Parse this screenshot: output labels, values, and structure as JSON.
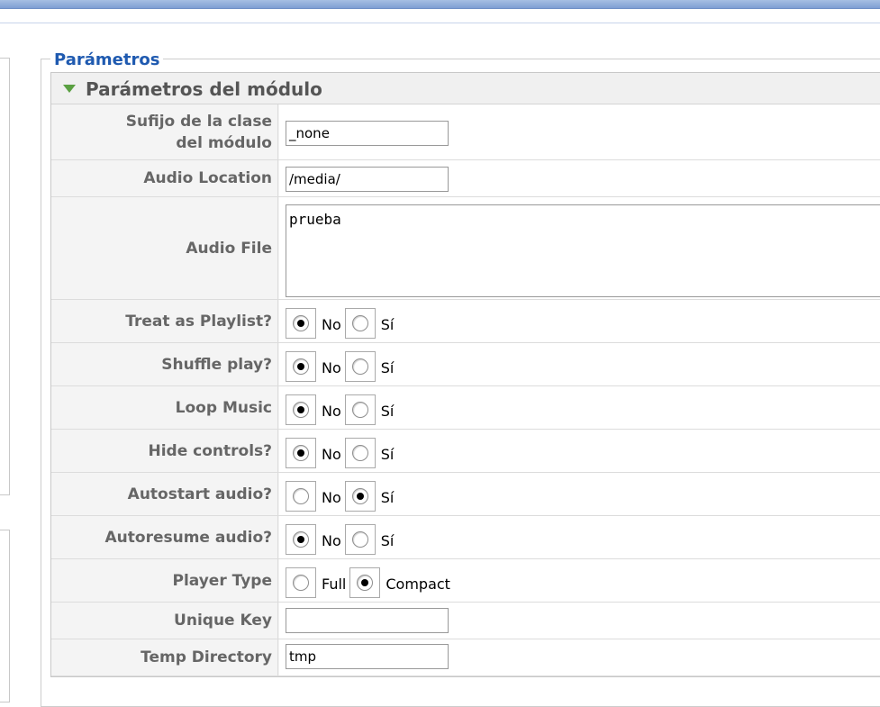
{
  "fieldset": {
    "legend": "Parámetros"
  },
  "panel": {
    "title": "Parámetros del módulo",
    "toggle_icon": "triangle-down-icon",
    "accent_color": "#5aa042"
  },
  "fields": {
    "module_class_suffix": {
      "label": "Sufijo de la clase del módulo",
      "value": "_none"
    },
    "audio_location": {
      "label": "Audio Location",
      "value": "/media/"
    },
    "audio_file": {
      "label": "Audio File",
      "value": "prueba"
    },
    "treat_as_playlist": {
      "label": "Treat as Playlist?",
      "options": [
        "No",
        "Sí"
      ],
      "selected": "No"
    },
    "shuffle_play": {
      "label": "Shuffle play?",
      "options": [
        "No",
        "Sí"
      ],
      "selected": "No"
    },
    "loop_music": {
      "label": "Loop Music",
      "options": [
        "No",
        "Sí"
      ],
      "selected": "No"
    },
    "hide_controls": {
      "label": "Hide controls?",
      "options": [
        "No",
        "Sí"
      ],
      "selected": "No"
    },
    "autostart_audio": {
      "label": "Autostart audio?",
      "options": [
        "No",
        "Sí"
      ],
      "selected": "Sí"
    },
    "autoresume_audio": {
      "label": "Autoresume audio?",
      "options": [
        "No",
        "Sí"
      ],
      "selected": "No"
    },
    "player_type": {
      "label": "Player Type",
      "options": [
        "Full",
        "Compact"
      ],
      "selected": "Compact"
    },
    "unique_key": {
      "label": "Unique Key",
      "value": ""
    },
    "temp_directory": {
      "label": "Temp Directory",
      "value": "tmp"
    }
  }
}
